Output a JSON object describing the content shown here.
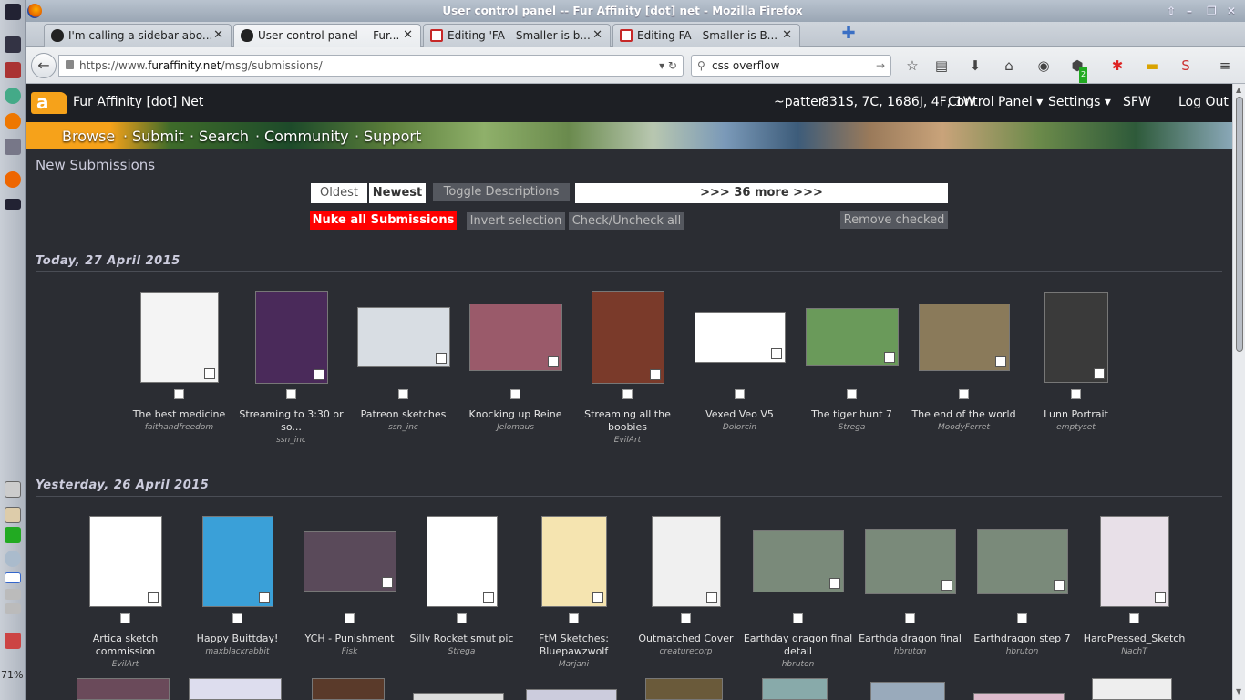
{
  "window": {
    "title": "User control panel -- Fur Affinity [dot] net - Mozilla Firefox",
    "controls": [
      "⇧",
      "–",
      "❐",
      "✕"
    ]
  },
  "tabs": [
    {
      "label": "I'm calling a sidebar abo...",
      "icon": "paw-icon",
      "active": false
    },
    {
      "label": "User control panel -- Fur...",
      "icon": "paw-icon",
      "active": true
    },
    {
      "label": "Editing 'FA - Smaller is b...",
      "icon": "stylish-icon",
      "active": false
    },
    {
      "label": "Editing FA - Smaller is B...",
      "icon": "stylish-icon",
      "active": false
    }
  ],
  "nav": {
    "url_prefix": "https://www.",
    "url_host": "furaffinity.net",
    "url_path": "/msg/submissions/",
    "search_value": "css overflow",
    "badge": "2"
  },
  "site": {
    "name": "Fur Affinity [dot] Net",
    "logo_text": "a",
    "user": "~patter",
    "counts": "831S, 7C, 1686J, 4F, 1W",
    "control_panel": "Control Panel ▾",
    "settings": "Settings ▾",
    "sfw": "SFW",
    "logout": "Log Out",
    "banner_links": [
      "Browse",
      "Submit",
      "Search",
      "Community",
      "Support"
    ],
    "banner_seps": [
      "·",
      "·",
      "·",
      "·"
    ]
  },
  "page": {
    "heading": "New Submissions",
    "oldest": "Oldest",
    "newest": "Newest",
    "toggle": "Toggle Descriptions",
    "more": ">>> 36 more >>>",
    "nuke": "Nuke all Submissions",
    "invert": "Invert selection",
    "checkall": "Check/Uncheck all",
    "remove": "Remove checked"
  },
  "days": [
    {
      "label": "Today, 27 April 2015",
      "items": [
        {
          "title": "The best medicine",
          "artist": "faithandfreedom",
          "color": "#f4f4f4"
        },
        {
          "title": "Streaming to 3:30 or so...",
          "artist": "ssn_inc",
          "color": "#4a2a5a"
        },
        {
          "title": "Patreon sketches",
          "artist": "ssn_inc",
          "color": "#d8dde3"
        },
        {
          "title": "Knocking up Reine",
          "artist": "Jelomaus",
          "color": "#9a5a6a"
        },
        {
          "title": "Streaming all the boobies",
          "artist": "EvilArt",
          "color": "#7a3a2a"
        },
        {
          "title": "Vexed Veo V5",
          "artist": "Dolorcin",
          "color": "#ffffff"
        },
        {
          "title": "The tiger hunt 7",
          "artist": "Strega",
          "color": "#6a9a5a"
        },
        {
          "title": "The end of the world",
          "artist": "MoodyFerret",
          "color": "#8a7a5a"
        },
        {
          "title": "Lunn Portrait",
          "artist": "emptyset",
          "color": "#3a3a3a"
        }
      ]
    },
    {
      "label": "Yesterday, 26 April 2015",
      "items": [
        {
          "title": "Artica sketch commission",
          "artist": "EvilArt",
          "color": "#ffffff"
        },
        {
          "title": "Happy Buittday!",
          "artist": "maxblackrabbit",
          "color": "#3aa0d8"
        },
        {
          "title": "YCH - Punishment",
          "artist": "Fisk",
          "color": "#5a4a5a"
        },
        {
          "title": "Silly Rocket smut pic",
          "artist": "Strega",
          "color": "#ffffff"
        },
        {
          "title": "FtM Sketches: Bluepawzwolf",
          "artist": "Marjani",
          "color": "#f5e4b0"
        },
        {
          "title": "Outmatched Cover",
          "artist": "creaturecorp",
          "color": "#f0f0f0"
        },
        {
          "title": "Earthday dragon final detail",
          "artist": "hbruton",
          "color": "#7a8a7a"
        },
        {
          "title": "Earthda dragon final",
          "artist": "hbruton",
          "color": "#7a8a7a"
        },
        {
          "title": "Earthdragon step 7",
          "artist": "hbruton",
          "color": "#7a8a7a"
        },
        {
          "title": "HardPressed_Sketch",
          "artist": "NachT",
          "color": "#e8e0e8"
        }
      ]
    }
  ],
  "dock": {
    "zoom": "71%"
  },
  "colors": {
    "nuke": "#ff0000",
    "accent": "#f6a21a",
    "page_bg": "#2b2d33"
  }
}
